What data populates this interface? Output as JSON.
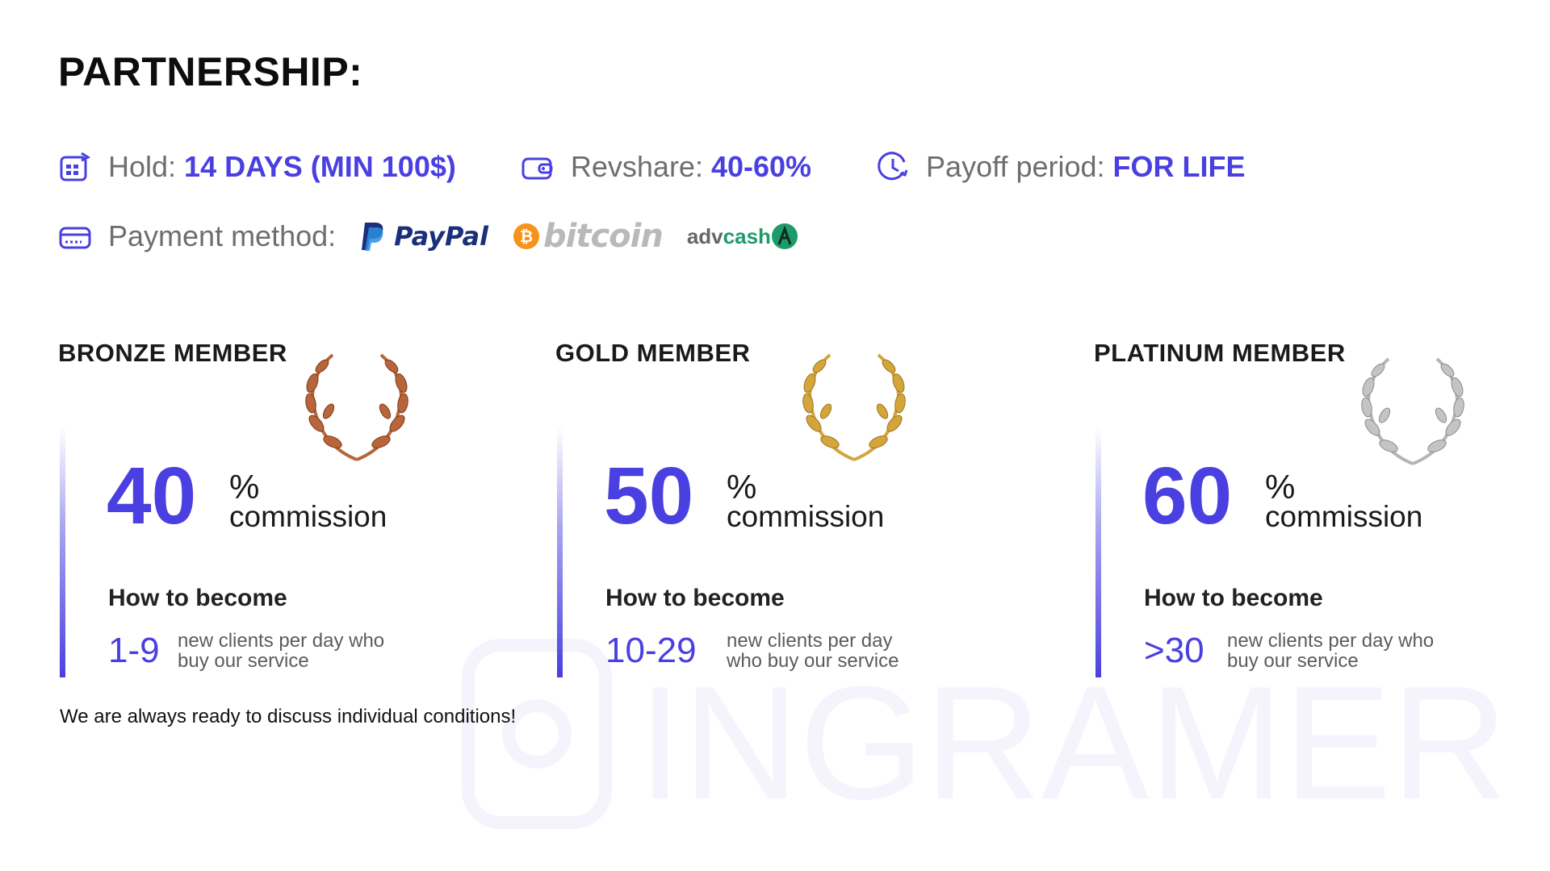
{
  "title": "PARTNERSHIP:",
  "info": {
    "hold_label": "Hold:",
    "hold_value": "14 DAYS (MIN 100$)",
    "revshare_label": "Revshare:",
    "revshare_value": "40-60%",
    "payoff_label": "Payoff period:",
    "payoff_value": "FOR LIFE",
    "payment_label": "Payment method:",
    "payment_methods": [
      "PayPal",
      "bitcoin",
      "advcash"
    ]
  },
  "tiers": [
    {
      "name": "BRONZE MEMBER",
      "commission": "40",
      "percent_sign": "%",
      "commission_label": "commission",
      "how_label": "How to become",
      "range": "1-9",
      "range_desc": "new clients per day who buy our service",
      "laurel_color": "#b8653a"
    },
    {
      "name": "GOLD MEMBER",
      "commission": "50",
      "percent_sign": "%",
      "commission_label": "commission",
      "how_label": "How to become",
      "range": "10-29",
      "range_desc": "new clients per day who buy our service",
      "laurel_color": "#d4a53a"
    },
    {
      "name": "PLATINUM MEMBER",
      "commission": "60",
      "percent_sign": "%",
      "commission_label": "commission",
      "how_label": "How to become",
      "range": ">30",
      "range_desc": "new clients per day who buy our service",
      "laurel_color": "#b5b5b5"
    }
  ],
  "footnote": "We are always ready to discuss individual conditions!",
  "watermark": "INGRAMER",
  "colors": {
    "accent": "#4a3fe0",
    "label_gray": "#6e6e6e"
  },
  "icons": [
    "calendar-icon",
    "wallet-icon",
    "clock-icon",
    "card-icon",
    "laurel-icon"
  ]
}
